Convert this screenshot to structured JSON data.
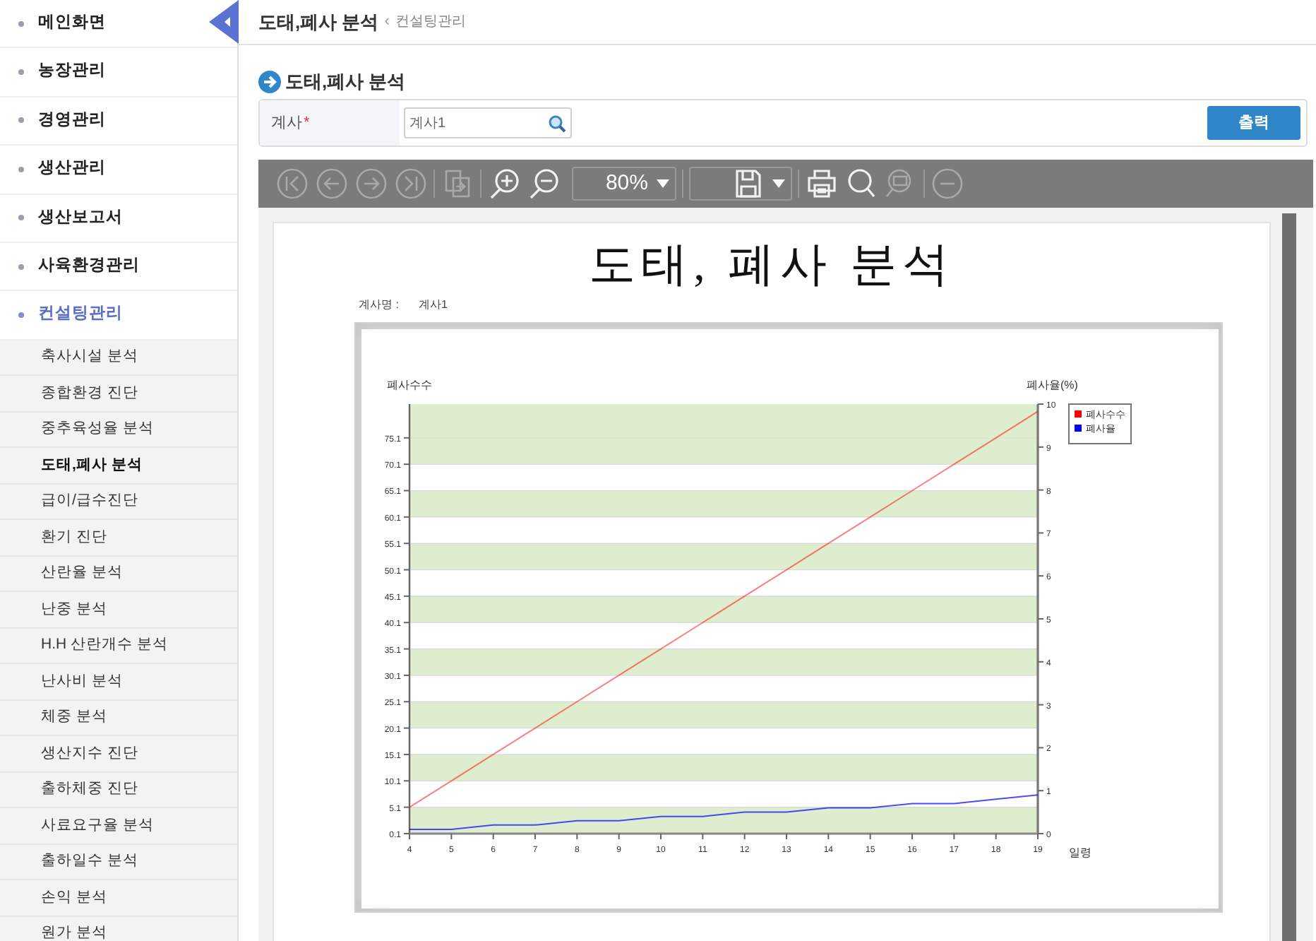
{
  "sidebar": {
    "items": [
      {
        "label": "메인화면",
        "selected": false
      },
      {
        "label": "농장관리",
        "selected": false
      },
      {
        "label": "경영관리",
        "selected": false
      },
      {
        "label": "생산관리",
        "selected": false
      },
      {
        "label": "생산보고서",
        "selected": false
      },
      {
        "label": "사육환경관리",
        "selected": false
      },
      {
        "label": "컨설팅관리",
        "selected": true,
        "expanded": true,
        "children": [
          {
            "label": "축사시설 분석",
            "selected": false
          },
          {
            "label": "종합환경 진단",
            "selected": false
          },
          {
            "label": "중추육성율 분석",
            "selected": false
          },
          {
            "label": "도태,폐사 분석",
            "selected": true
          },
          {
            "label": "급이/급수진단",
            "selected": false
          },
          {
            "label": "환기 진단",
            "selected": false
          },
          {
            "label": "산란율 분석",
            "selected": false
          },
          {
            "label": "난중 분석",
            "selected": false
          },
          {
            "label": "H.H 산란개수 분석",
            "selected": false
          },
          {
            "label": "난사비 분석",
            "selected": false
          },
          {
            "label": "체중 분석",
            "selected": false
          },
          {
            "label": "생산지수 진단",
            "selected": false
          },
          {
            "label": "출하체중 진단",
            "selected": false
          },
          {
            "label": "사료요구율 분석",
            "selected": false
          },
          {
            "label": "출하일수 분석",
            "selected": false
          },
          {
            "label": "손익 분석",
            "selected": false
          },
          {
            "label": "원가 분석",
            "selected": false
          }
        ]
      }
    ]
  },
  "breadcrumb": {
    "title": "도태,폐사 분석",
    "separator": "‹",
    "parent": "컨설팅관리"
  },
  "section_title": "도태,폐사 분석",
  "filter": {
    "label": "계사",
    "required_mark": "*",
    "value": "계사1"
  },
  "print_button": "출력",
  "viewer": {
    "zoom": "80%"
  },
  "report": {
    "title": "도태, 폐사 분석",
    "house_label": "계사명 :",
    "house_value": "계사1",
    "chart_data": {
      "type": "line",
      "xlabel": "일령",
      "ylabel": "폐사수수",
      "y2label": "폐사율(%)",
      "legend": true,
      "xlim": [
        4,
        19
      ],
      "x": [
        4,
        5,
        6,
        7,
        8,
        9,
        10,
        11,
        12,
        13,
        14,
        15,
        16,
        17,
        18,
        19
      ],
      "ylim": [
        0.1,
        81.5
      ],
      "yticks": [
        0.1,
        5.1,
        10.1,
        15.1,
        20.1,
        25.1,
        30.1,
        35.1,
        40.1,
        45.1,
        50.1,
        55.1,
        60.1,
        65.1,
        70.1,
        75.1
      ],
      "y2lim": [
        0,
        10
      ],
      "y2ticks": [
        0,
        1,
        2,
        3,
        4,
        5,
        6,
        7,
        8,
        9,
        10
      ],
      "xticks": [
        4,
        5,
        6,
        7,
        8,
        9,
        10,
        11,
        12,
        13,
        14,
        15,
        16,
        17,
        18,
        19
      ],
      "series": [
        {
          "name": "폐사수수",
          "color": "#ff0000",
          "axis": "y",
          "values": [
            5.1,
            10.1,
            15.1,
            20.1,
            25.1,
            30.1,
            35.1,
            40.1,
            45.1,
            50.1,
            55.1,
            60.1,
            65.1,
            70.1,
            75.1,
            80.1
          ]
        },
        {
          "name": "폐사율",
          "color": "#0000ff",
          "axis": "y2",
          "values": [
            0.1,
            0.1,
            0.2,
            0.2,
            0.3,
            0.3,
            0.4,
            0.4,
            0.5,
            0.5,
            0.6,
            0.6,
            0.7,
            0.7,
            0.8,
            0.9
          ]
        }
      ]
    }
  }
}
